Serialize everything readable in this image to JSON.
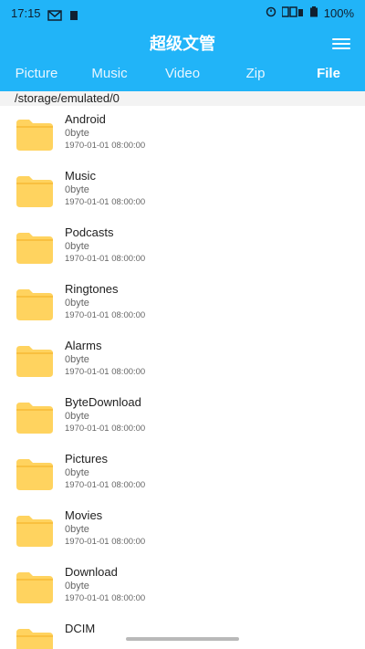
{
  "status": {
    "time": "17:15",
    "battery": "100%",
    "net_labels": [
      "5G",
      "5G"
    ]
  },
  "header": {
    "title": "超级文管"
  },
  "tabs": [
    {
      "label": "Picture"
    },
    {
      "label": "Music"
    },
    {
      "label": "Video"
    },
    {
      "label": "Zip"
    },
    {
      "label": "File"
    }
  ],
  "path": "/storage/emulated/0",
  "files": [
    {
      "name": "Android",
      "size": "0byte",
      "date": "1970-01-01 08:00:00"
    },
    {
      "name": "Music",
      "size": "0byte",
      "date": "1970-01-01 08:00:00"
    },
    {
      "name": "Podcasts",
      "size": "0byte",
      "date": "1970-01-01 08:00:00"
    },
    {
      "name": "Ringtones",
      "size": "0byte",
      "date": "1970-01-01 08:00:00"
    },
    {
      "name": "Alarms",
      "size": "0byte",
      "date": "1970-01-01 08:00:00"
    },
    {
      "name": "ByteDownload",
      "size": "0byte",
      "date": "1970-01-01 08:00:00"
    },
    {
      "name": "Pictures",
      "size": "0byte",
      "date": "1970-01-01 08:00:00"
    },
    {
      "name": "Movies",
      "size": "0byte",
      "date": "1970-01-01 08:00:00"
    },
    {
      "name": "Download",
      "size": "0byte",
      "date": "1970-01-01 08:00:00"
    },
    {
      "name": "DCIM",
      "size": "",
      "date": ""
    }
  ],
  "colors": {
    "primary": "#21b4f8",
    "folder": "#ffd35f",
    "folder_tab": "#f9c03f"
  },
  "icons": {
    "menu": "hamburger-menu-icon",
    "folder": "folder-icon",
    "mail": "mail-icon",
    "clock": "alarm-icon",
    "battery": "battery-icon"
  }
}
